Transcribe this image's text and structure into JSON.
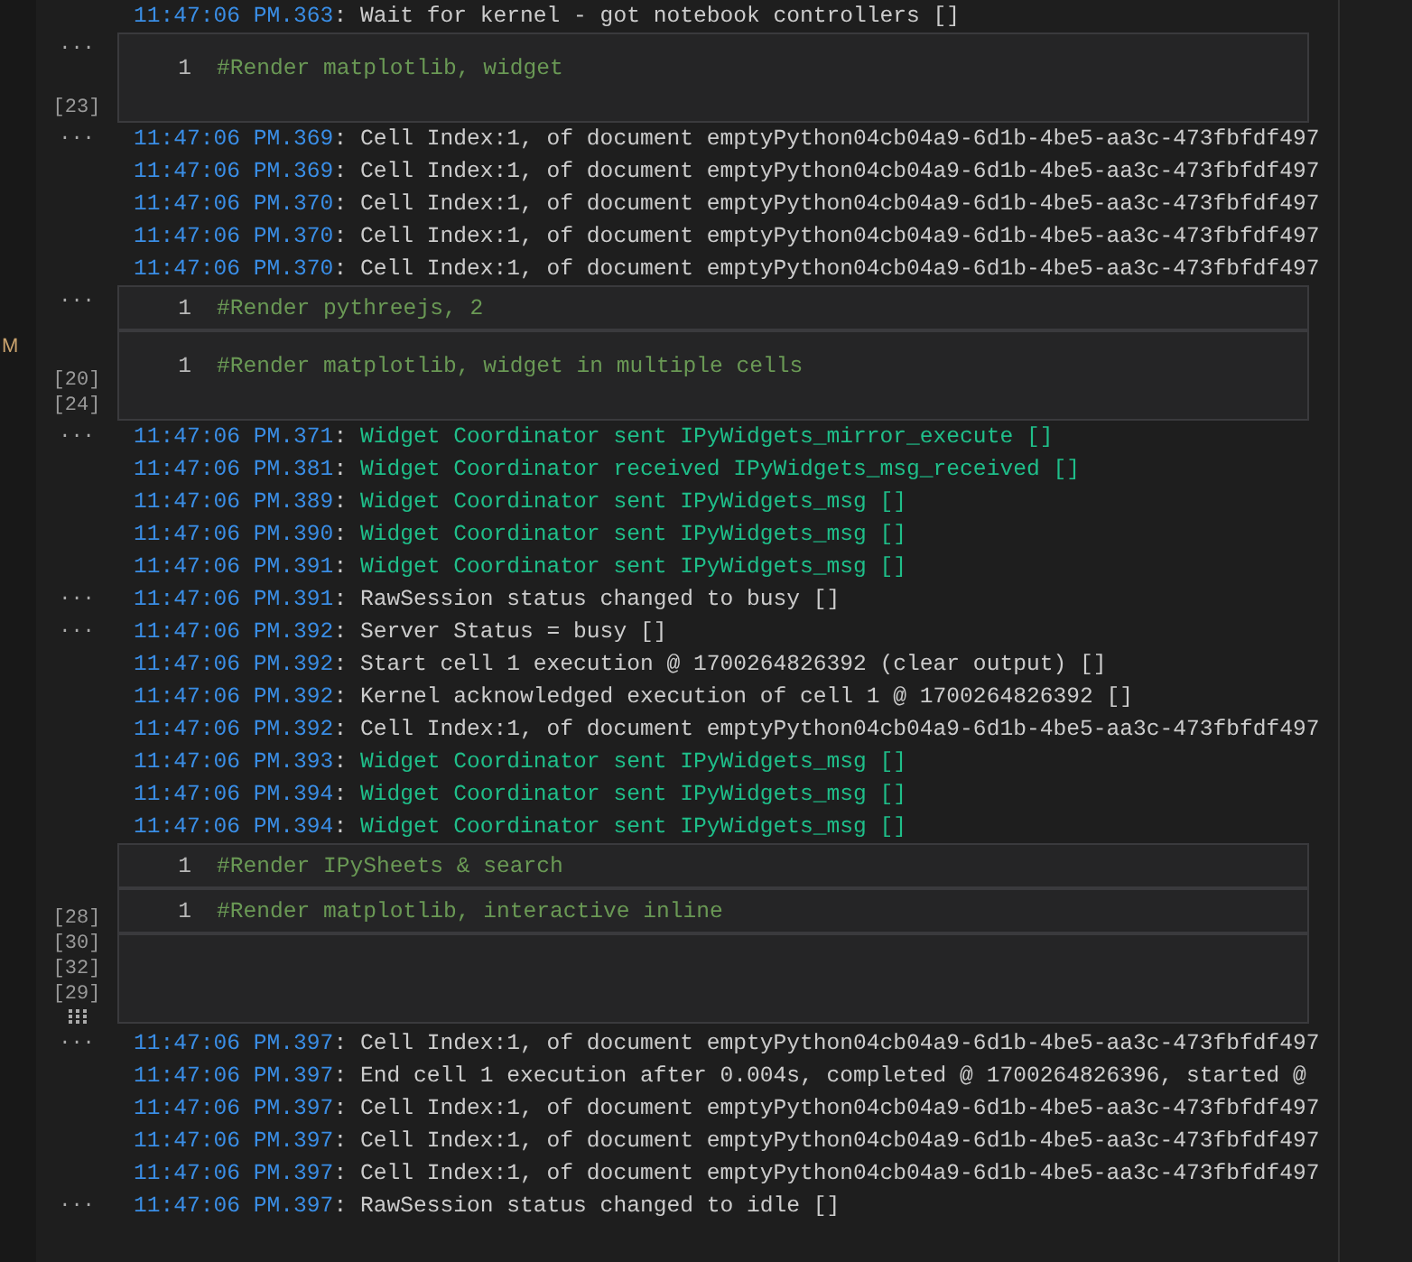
{
  "side_marker": "M",
  "blocks": [
    {
      "kind": "log",
      "lines": [
        {
          "time": "11:47:06 PM.363",
          "separator": ":",
          "message": "Wait for kernel - got notebook controllers []",
          "kind": "kernel"
        }
      ]
    },
    {
      "kind": "cell",
      "gutter": "...",
      "line_number": "1",
      "code": "#Render matplotlib, widget",
      "exec_counts": [
        "[23]"
      ]
    },
    {
      "kind": "log",
      "lines": [
        {
          "gutter": "...",
          "time": "11:47:06 PM.369",
          "separator": ":",
          "message": "Cell Index:1, of document emptyPython04cb04a9-6d1b-4be5-aa3c-473fbfdf497",
          "kind": "kernel"
        },
        {
          "time": "11:47:06 PM.369",
          "separator": ":",
          "message": "Cell Index:1, of document emptyPython04cb04a9-6d1b-4be5-aa3c-473fbfdf497",
          "kind": "kernel"
        },
        {
          "time": "11:47:06 PM.370",
          "separator": ":",
          "message": "Cell Index:1, of document emptyPython04cb04a9-6d1b-4be5-aa3c-473fbfdf497",
          "kind": "kernel"
        },
        {
          "time": "11:47:06 PM.370",
          "separator": ":",
          "message": "Cell Index:1, of document emptyPython04cb04a9-6d1b-4be5-aa3c-473fbfdf497",
          "kind": "kernel"
        },
        {
          "time": "11:47:06 PM.370",
          "separator": ":",
          "message": "Cell Index:1, of document emptyPython04cb04a9-6d1b-4be5-aa3c-473fbfdf497",
          "kind": "kernel"
        }
      ]
    },
    {
      "kind": "slimcell",
      "gutter": "...",
      "line_number": "1",
      "code": "#Render pythreejs, 2"
    },
    {
      "kind": "cell",
      "line_number": "1",
      "code": "#Render matplotlib, widget in multiple cells",
      "exec_counts": [
        "[20]",
        "[24]"
      ]
    },
    {
      "kind": "log",
      "lines": [
        {
          "gutter": "...",
          "time": "11:47:06 PM.371",
          "separator": ":",
          "message": "Widget Coordinator sent IPyWidgets_mirror_execute []",
          "kind": "widget"
        },
        {
          "time": "11:47:06 PM.381",
          "separator": ":",
          "message": "Widget Coordinator received IPyWidgets_msg_received []",
          "kind": "widget"
        },
        {
          "time": "11:47:06 PM.389",
          "separator": ":",
          "message": "Widget Coordinator sent IPyWidgets_msg []",
          "kind": "widget"
        },
        {
          "time": "11:47:06 PM.390",
          "separator": ":",
          "message": "Widget Coordinator sent IPyWidgets_msg []",
          "kind": "widget"
        },
        {
          "time": "11:47:06 PM.391",
          "separator": ":",
          "message": "Widget Coordinator sent IPyWidgets_msg []",
          "kind": "widget"
        },
        {
          "gutter": "...",
          "time": "11:47:06 PM.391",
          "separator": ":",
          "message": "RawSession status changed to busy []",
          "kind": "kernel"
        },
        {
          "gutter": "...",
          "time": "11:47:06 PM.392",
          "separator": ":",
          "message": "Server Status = busy []",
          "kind": "kernel"
        },
        {
          "time": "11:47:06 PM.392",
          "separator": ":",
          "message": "Start cell 1 execution @ 1700264826392 (clear output) []",
          "kind": "kernel"
        },
        {
          "time": "11:47:06 PM.392",
          "separator": ":",
          "message": "Kernel acknowledged execution of cell 1 @ 1700264826392 []",
          "kind": "kernel"
        },
        {
          "time": "11:47:06 PM.392",
          "separator": ":",
          "message": "Cell Index:1, of document emptyPython04cb04a9-6d1b-4be5-aa3c-473fbfdf497",
          "kind": "kernel"
        },
        {
          "time": "11:47:06 PM.393",
          "separator": ":",
          "message": "Widget Coordinator sent IPyWidgets_msg []",
          "kind": "widget"
        },
        {
          "time": "11:47:06 PM.394",
          "separator": ":",
          "message": "Widget Coordinator sent IPyWidgets_msg []",
          "kind": "widget"
        },
        {
          "time": "11:47:06 PM.394",
          "separator": ":",
          "message": "Widget Coordinator sent IPyWidgets_msg []",
          "kind": "widget"
        }
      ]
    },
    {
      "kind": "slimcell",
      "line_number": "1",
      "code": "#Render IPySheets & search"
    },
    {
      "kind": "slimcell",
      "line_number": "1",
      "code": "#Render matplotlib, interactive inline",
      "exec_counts": [
        "[28]"
      ]
    },
    {
      "kind": "cell",
      "exec_counts": [
        "[30]",
        "[32]",
        "[29]"
      ]
    },
    {
      "kind": "log",
      "lines": [
        {
          "gutter": "...",
          "time": "11:47:06 PM.397",
          "separator": ":",
          "message": "Cell Index:1, of document emptyPython04cb04a9-6d1b-4be5-aa3c-473fbfdf497",
          "kind": "kernel"
        },
        {
          "time": "11:47:06 PM.397",
          "separator": ":",
          "message": "End cell 1 execution after 0.004s, completed @ 1700264826396, started @",
          "kind": "kernel"
        },
        {
          "time": "11:47:06 PM.397",
          "separator": ":",
          "message": "Cell Index:1, of document emptyPython04cb04a9-6d1b-4be5-aa3c-473fbfdf497",
          "kind": "kernel"
        },
        {
          "time": "11:47:06 PM.397",
          "separator": ":",
          "message": "Cell Index:1, of document emptyPython04cb04a9-6d1b-4be5-aa3c-473fbfdf497",
          "kind": "kernel"
        },
        {
          "time": "11:47:06 PM.397",
          "separator": ":",
          "message": "Cell Index:1, of document emptyPython04cb04a9-6d1b-4be5-aa3c-473fbfdf497",
          "kind": "kernel"
        },
        {
          "gutter": "...",
          "time": "11:47:06 PM.397",
          "separator": ":",
          "message": "RawSession status changed to idle []",
          "kind": "kernel"
        }
      ]
    }
  ]
}
